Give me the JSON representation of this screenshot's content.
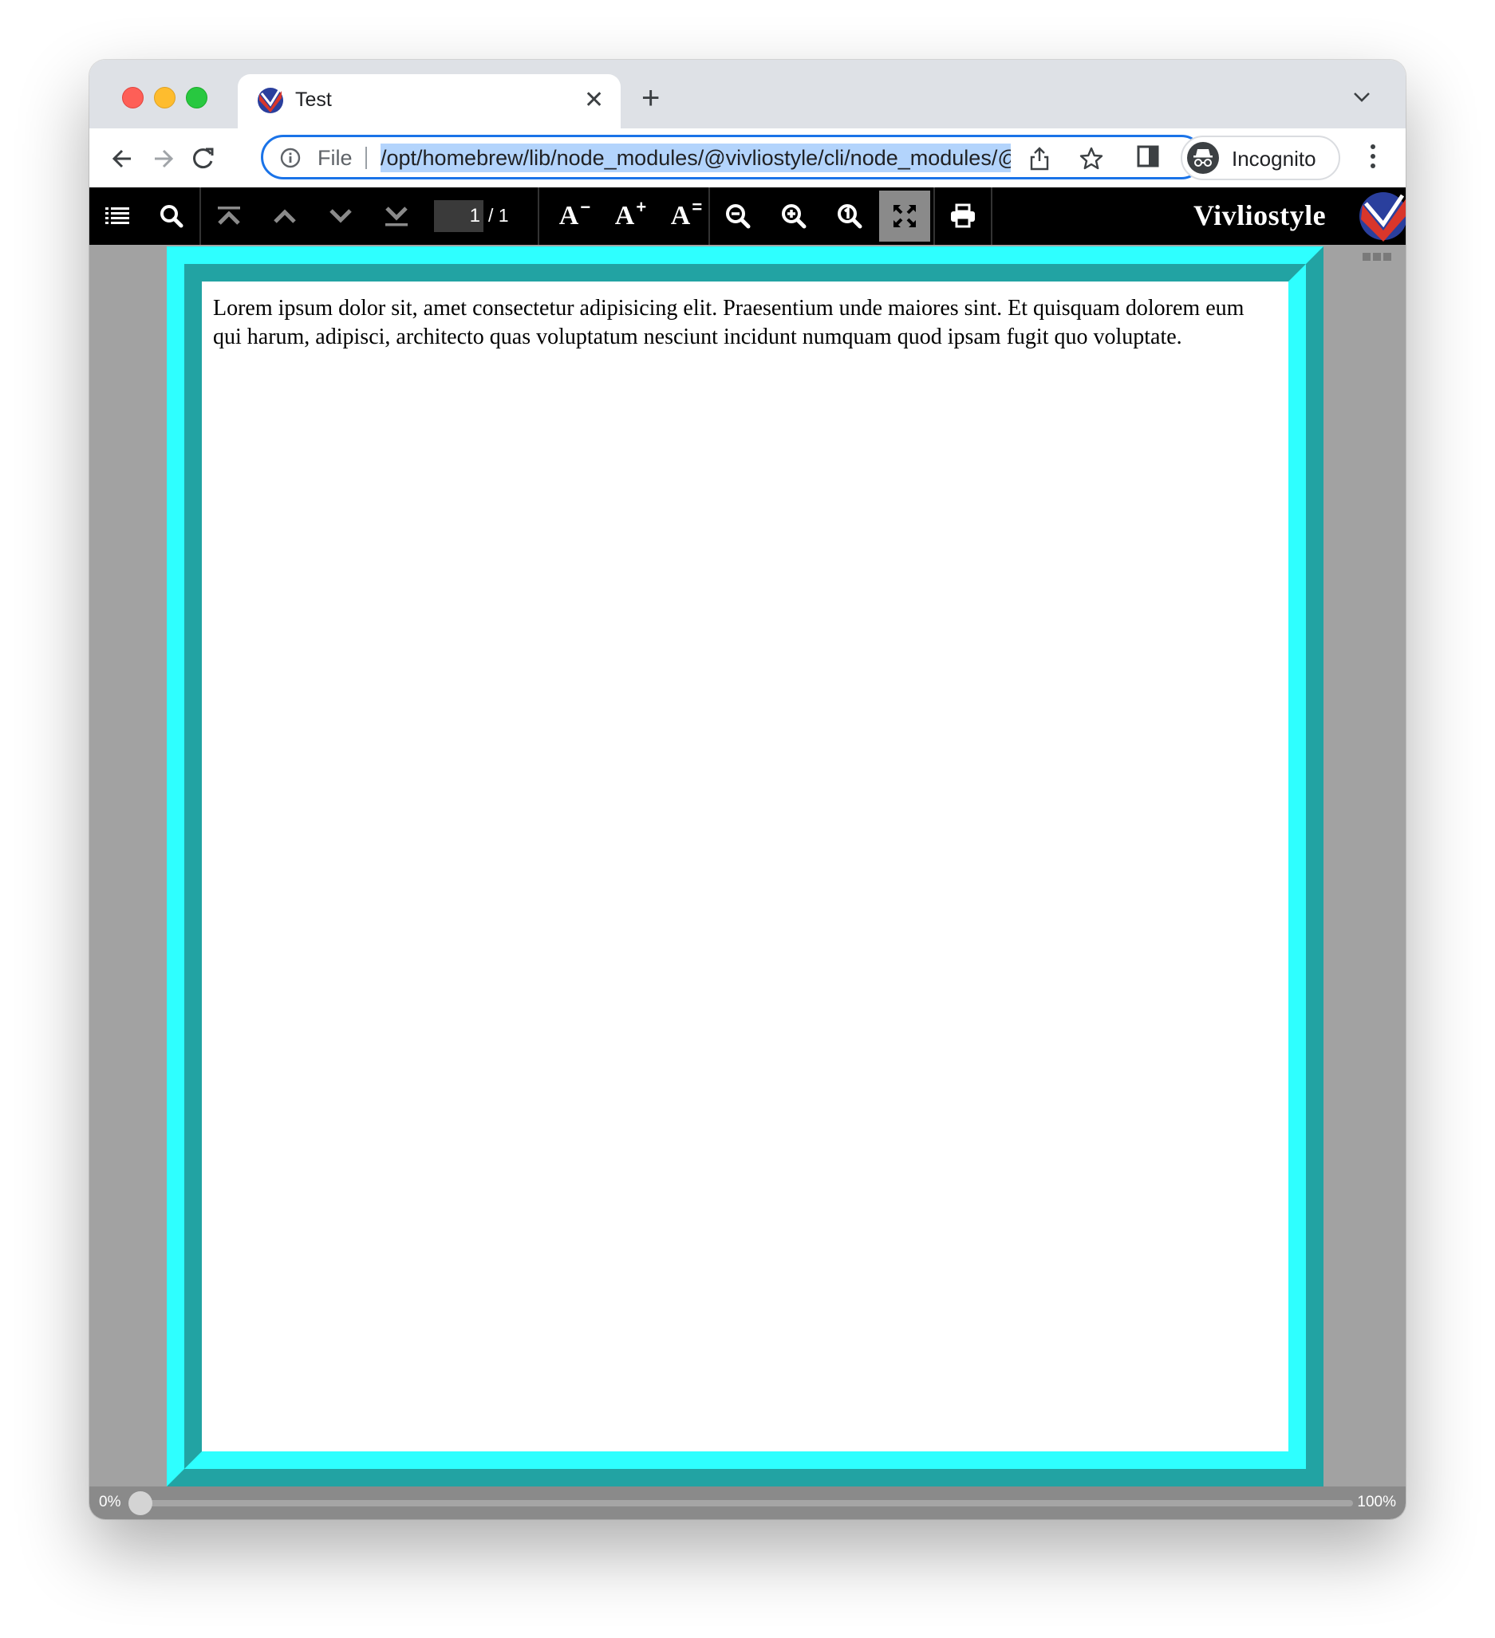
{
  "browser": {
    "tab_title": "Test",
    "omnibox": {
      "scheme_label": "File",
      "url": "/opt/homebrew/lib/node_modules/@vivliostyle/cli/node_modules/@vivliostyle/viewer/lib/index.html"
    },
    "profile_label": "Incognito"
  },
  "viewer": {
    "toolbar_buttons": [
      "toc-icon",
      "search-icon",
      "first-page-icon",
      "previous-page-icon",
      "next-page-icon",
      "last-page-icon",
      "font-size-decrease-icon",
      "font-size-increase-icon",
      "font-size-reset-icon",
      "zoom-out-icon",
      "zoom-in-icon",
      "zoom-actual-size-icon",
      "fit-to-screen-icon",
      "print-icon"
    ],
    "page_number": "1",
    "page_total": "/ 1",
    "font_labels": {
      "decrease": "A",
      "decrease_mark": "−",
      "increase": "A",
      "increase_mark": "+",
      "reset": "A",
      "reset_mark": "="
    },
    "brand": "Vivliostyle",
    "document_text": "Lorem ipsum dolor sit, amet consectetur adipisicing elit. Praesentium unde maiores sint. Et quisquam dolorem eum qui harum, adipisci, architecto quas voluptatum nesciunt incidunt numquam quod ipsam fugit quo voluptate.",
    "progress": {
      "start_label": "0%",
      "end_label": "100%",
      "value": 0
    }
  },
  "colors": {
    "page_border_light": "#2effff",
    "page_border_dark": "#22a3a3",
    "viewer_background": "#a2a2a2",
    "omnibox_focus": "#1a73e8",
    "selection": "#b3d4fc"
  }
}
